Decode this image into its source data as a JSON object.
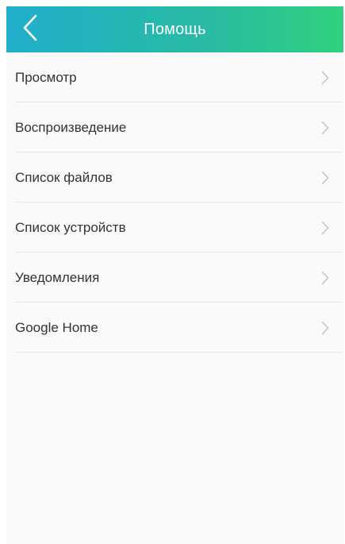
{
  "header": {
    "title": "Помощь",
    "back_icon": "chevron-left-icon",
    "gradient_start": "#20aecb",
    "gradient_end": "#2fd17d"
  },
  "menu": {
    "items": [
      {
        "label": "Просмотр",
        "icon": "chevron-right-icon"
      },
      {
        "label": "Воспроизведение",
        "icon": "chevron-right-icon"
      },
      {
        "label": "Список файлов",
        "icon": "chevron-right-icon"
      },
      {
        "label": "Список устройств",
        "icon": "chevron-right-icon"
      },
      {
        "label": "Уведомления",
        "icon": "chevron-right-icon"
      },
      {
        "label": "Google Home",
        "icon": "chevron-right-icon"
      }
    ]
  }
}
